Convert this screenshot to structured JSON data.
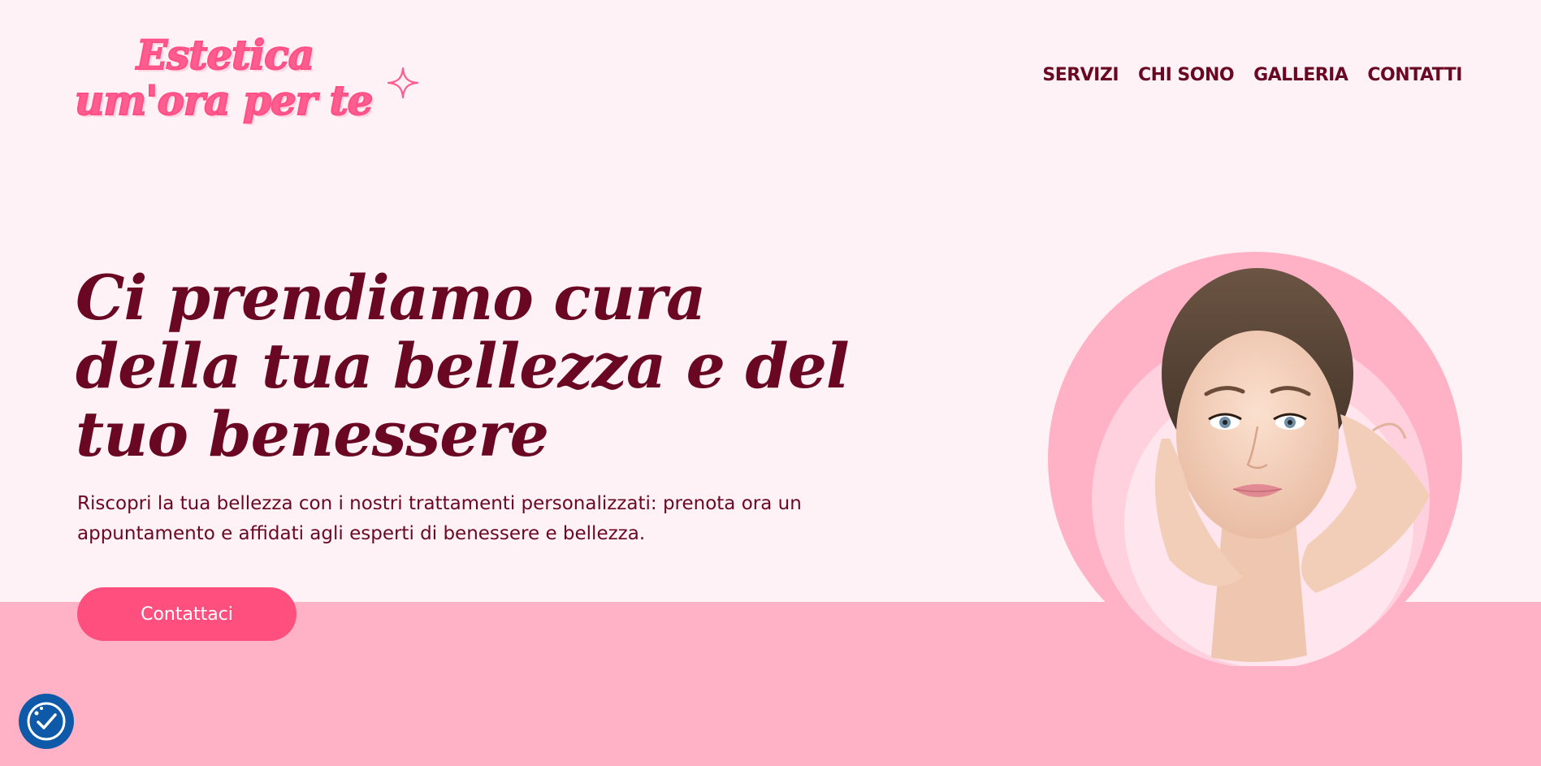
{
  "brand": {
    "logo_line_1": "Estetica",
    "logo_line_2": "um'ora per te"
  },
  "nav": {
    "items": [
      {
        "label": "SERVIZI"
      },
      {
        "label": "CHI SONO"
      },
      {
        "label": "GALLERIA"
      },
      {
        "label": "CONTATTI"
      }
    ]
  },
  "hero": {
    "title": "Ci prendiamo cura della tua bellezza e del tuo benessere",
    "subtitle": "Riscopri la tua bellezza con i nostri trattamenti personalizzati: prenota ora un appuntamento e affidati agli esperti di benessere e bellezza.",
    "cta_label": "Contattaci"
  },
  "icons": {
    "sparkle": "sparkle-icon",
    "cookie": "cookie-consent-icon"
  },
  "colors": {
    "background": "#fff2f6",
    "band": "#ffb1c6",
    "text_primary": "#6a0824",
    "accent": "#ff4f7e",
    "logo_pink": "#ff5c8f",
    "cookie_badge": "#0e5aa8"
  }
}
